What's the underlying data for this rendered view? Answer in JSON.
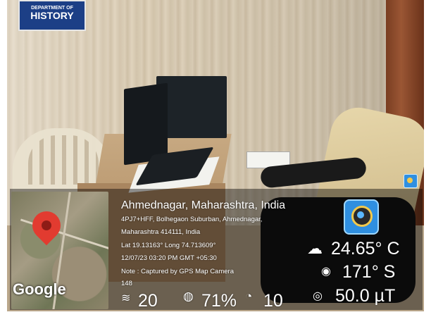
{
  "sign": {
    "line1": "DEPARTMENT OF",
    "line2": "HISTORY"
  },
  "overlay": {
    "city": "Ahmednagar, Maharashtra, India",
    "address_line1": "4PJ7+HFF, Bolhegaon Suburban, Ahmednagar,",
    "address_line2": "Maharashtra 414111, India",
    "coordinates": "Lat 19.13163° Long 74.713609°",
    "datetime": "12/07/23 03:20 PM GMT +05:30",
    "note": "Note : Captured by GPS Map Camera",
    "note_extra": "148",
    "map_logo": "Google",
    "temperature": "24.65° C",
    "compass": "171° S",
    "magnetic": "50.0 µT",
    "wind": "20",
    "humidity": "71%",
    "pressure": "10",
    "icons": {
      "map_pin": "map-pin-icon",
      "weather": "partly-cloudy-icon",
      "compass": "compass-icon",
      "magnetic": "magnet-icon",
      "wind": "wind-icon",
      "humidity": "humidity-icon",
      "pressure": "gauge-icon",
      "app": "gps-camera-app-icon"
    }
  }
}
